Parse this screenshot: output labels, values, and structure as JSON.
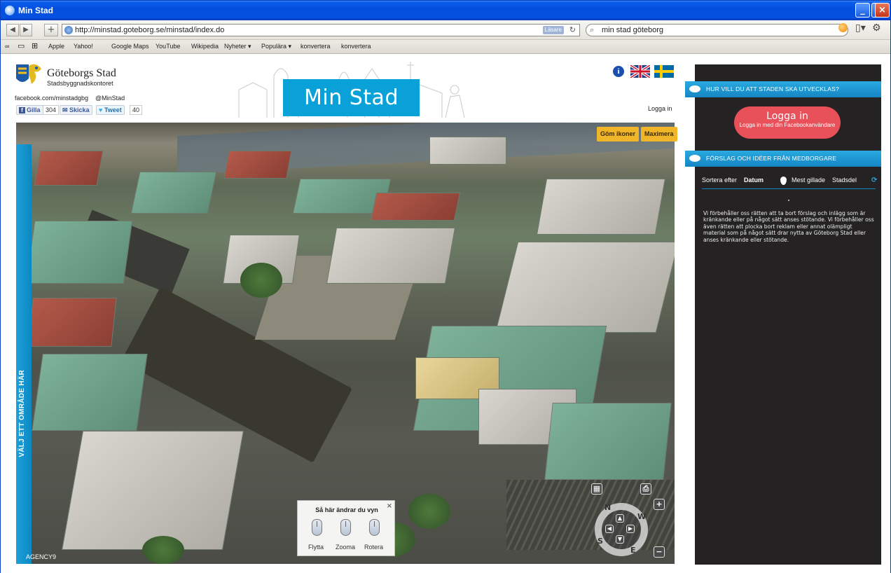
{
  "window": {
    "title": "Min Stad"
  },
  "browser": {
    "url": "http://minstad.goteborg.se/minstad/index.do",
    "reader_label": "Läsare",
    "search_value": "min stad göteborg",
    "bookmarks": [
      "Apple",
      "Yahoo!",
      "Google Maps",
      "YouTube",
      "Wikipedia",
      "Nyheter ▾",
      "Populära ▾",
      "konvertera",
      "konvertera"
    ]
  },
  "header": {
    "org_name": "Göteborgs Stad",
    "org_sub": "Stadsbyggnadskontoret",
    "facebook_link": "facebook.com/minstadgbg",
    "twitter_link": "@MinStad",
    "fb_like_label": "Gilla",
    "fb_like_count": "304",
    "send_label": "Skicka",
    "tweet_label": "Tweet",
    "tweet_count": "40",
    "banner": "Min Stad",
    "login_link": "Logga in",
    "info_icon_text": "i"
  },
  "map": {
    "hide_icons_label": "Göm ikoner",
    "maximize_label": "Maximera",
    "side_label": "VÄLJ ETT OMRÅDE HÄR",
    "credit": "AGENCY9",
    "help": {
      "title": "Så här ändrar du vyn",
      "close": "×",
      "move": "Flytta",
      "zoom": "Zooma",
      "rotate": "Rotera"
    },
    "compass": {
      "n": "N",
      "s": "S",
      "e": "E",
      "w": "W"
    }
  },
  "panel": {
    "heading1": "HUR VILL DU ATT STADEN SKA UTVECKLAS?",
    "login_title": "Logga in",
    "login_sub": "Logga in med din Facebookanvändare",
    "heading2": "FÖRSLAG OCH IDÉER FRÅN MEDBORGARE",
    "sort_prefix": "Sortera efter",
    "sort_date": "Datum",
    "sort_liked": "Mest gillade",
    "sort_district": "Stadsdel",
    "disclaimer": "Vi förbehåller oss rätten att ta bort förslag och inlägg som är kränkande eller på något sätt anses stötande. Vi förbehåller oss även rätten att plocka bort reklam eller annat olämpligt material som på något sätt drar nytta av Göteborg Stad eller anses kränkande eller stötande."
  },
  "colors": {
    "brand_blue": "#0aa0d8",
    "login_red": "#e8505a",
    "panel_bg": "#242223",
    "map_button": "#f1b52a"
  }
}
